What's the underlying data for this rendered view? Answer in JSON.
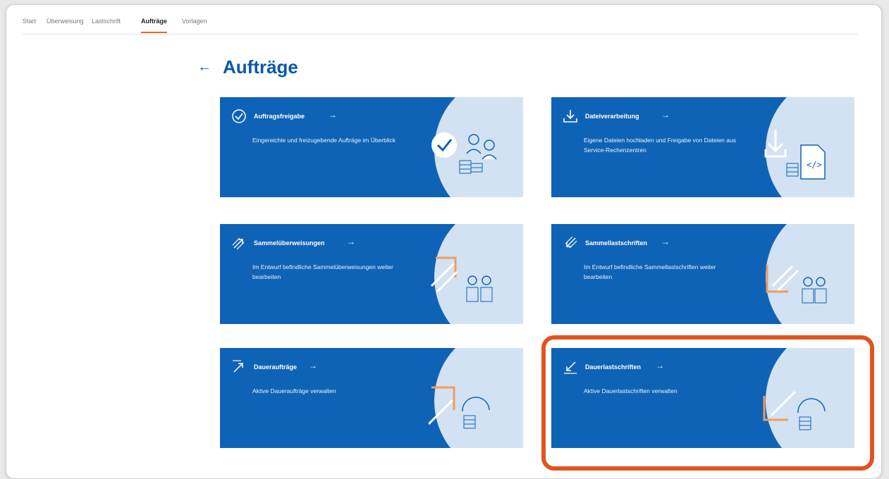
{
  "nav": {
    "items": [
      "Start",
      "Überweisung",
      "Lastschrift",
      "Aufträge",
      "Vorlagen"
    ],
    "active": "Aufträge"
  },
  "page": {
    "back_icon": "←",
    "title": "Aufträge"
  },
  "tiles": [
    {
      "title": "Auftragsfreigabe",
      "arrow": "→",
      "desc": "Eingereichte und freizugebende Aufträge im Überblick",
      "icon": "check-circle-icon"
    },
    {
      "title": "Dateiverarbeitung",
      "arrow": "→",
      "desc": "Eigene Dateien hochladen und Freigabe von Dateien aus Service-Rechenzentren",
      "icon": "download-icon"
    },
    {
      "title": "Sammelüberweisungen",
      "arrow": "→",
      "desc": "Im Entwurf befindliche Sammelüberweisungen weiter bearbeiten",
      "icon": "outgoing-arrows-icon"
    },
    {
      "title": "Sammellastschriften",
      "arrow": "→",
      "desc": "Im Entwurf befindliche Sammellastschriften weiter bearbeiten",
      "icon": "incoming-arrows-icon"
    },
    {
      "title": "Daueraufträge",
      "arrow": "→",
      "desc": "Aktive Daueraufträge verwalten",
      "icon": "outgoing-arrow-icon"
    },
    {
      "title": "Dauerlastschriften",
      "arrow": "→",
      "desc": "Aktive Dauerlastschriften verwalten",
      "icon": "incoming-arrow-icon"
    }
  ],
  "colors": {
    "tile_blue": "#0f63b6",
    "light_circle": "#d2e2f3",
    "accent_orange": "#e46a2f",
    "title_blue": "#0a59a8",
    "highlight_red": "#e2541f"
  }
}
